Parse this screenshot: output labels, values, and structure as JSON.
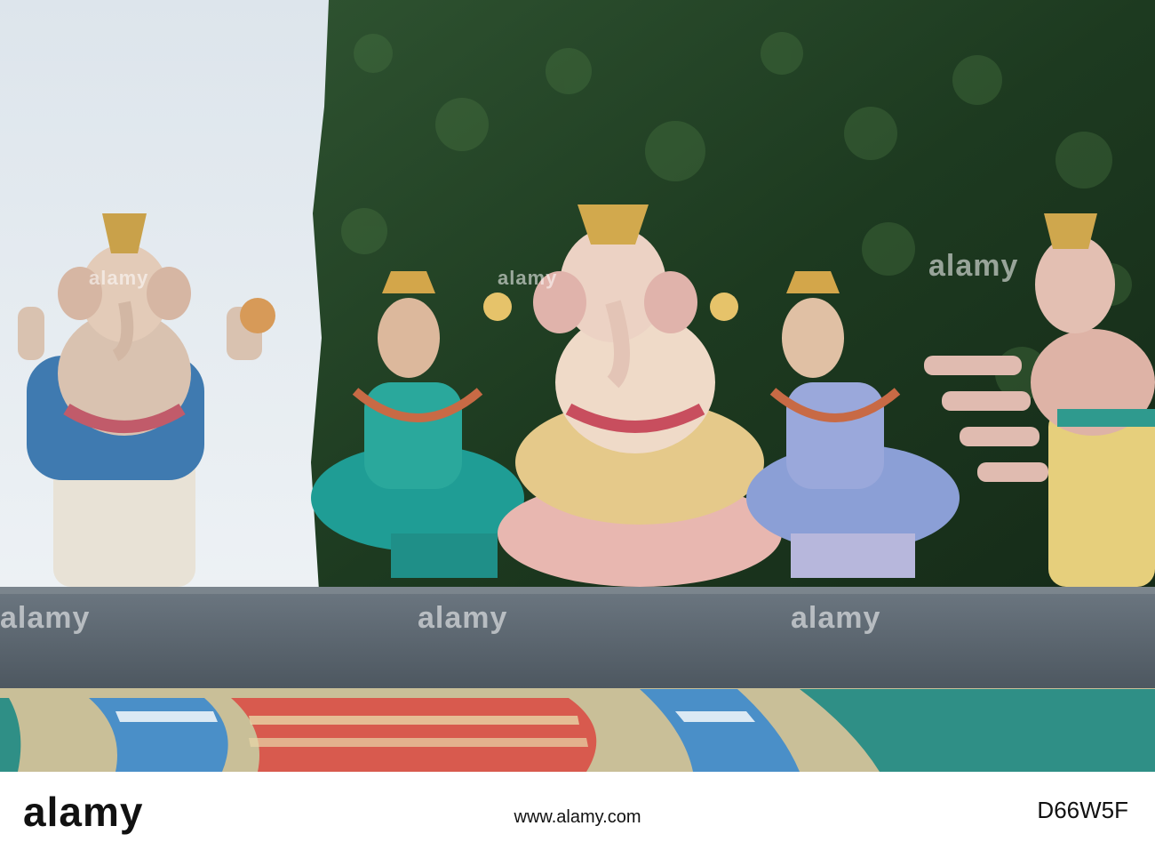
{
  "watermark": {
    "brand": "alamy",
    "code": "D66W5F",
    "url": "www.alamy.com"
  },
  "colors": {
    "sky": "#e6ecf1",
    "foliage": "#1f3a22",
    "ledge": "#5c6770",
    "stripe_red": "#d85a4e",
    "stripe_blue": "#4a8fc8",
    "stripe_teal": "#2f8f86"
  }
}
